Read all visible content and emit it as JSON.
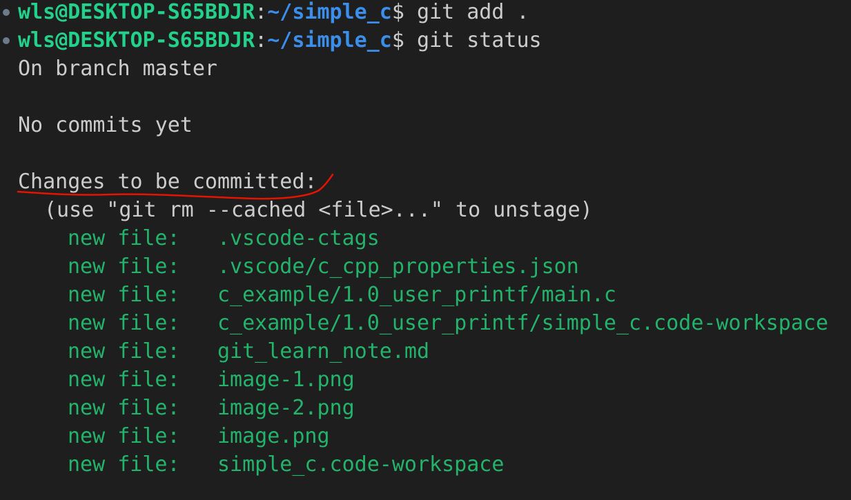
{
  "prompts": [
    {
      "user": "wls@DESKTOP-S65BDJR",
      "colon": ":",
      "path": "~/simple_c",
      "dollar": "$",
      "command": " git add ."
    },
    {
      "user": "wls@DESKTOP-S65BDJR",
      "colon": ":",
      "path": "~/simple_c",
      "dollar": "$",
      "command": " git status"
    }
  ],
  "output": {
    "branch_line": "On branch master",
    "commits_line": "No commits yet",
    "changes_header": "Changes to be committed:",
    "hint": "(use \"git rm --cached <file>...\" to unstage)",
    "files": [
      {
        "status": "new file:",
        "path": ".vscode-ctags"
      },
      {
        "status": "new file:",
        "path": ".vscode/c_cpp_properties.json"
      },
      {
        "status": "new file:",
        "path": "c_example/1.0_user_printf/main.c"
      },
      {
        "status": "new file:",
        "path": "c_example/1.0_user_printf/simple_c.code-workspace"
      },
      {
        "status": "new file:",
        "path": "git_learn_note.md"
      },
      {
        "status": "new file:",
        "path": "image-1.png"
      },
      {
        "status": "new file:",
        "path": "image-2.png"
      },
      {
        "status": "new file:",
        "path": "image.png"
      },
      {
        "status": "new file:",
        "path": "simple_c.code-workspace"
      }
    ]
  },
  "colors": {
    "background": "#1e1e1e",
    "user": "#23d18b",
    "path": "#3b8eea",
    "staged_file": "#23b36b",
    "annotation": "#e51400"
  },
  "icons": {
    "prompt_marker": "circle-decoration-icon",
    "annotation": "red-underline-annotation"
  }
}
